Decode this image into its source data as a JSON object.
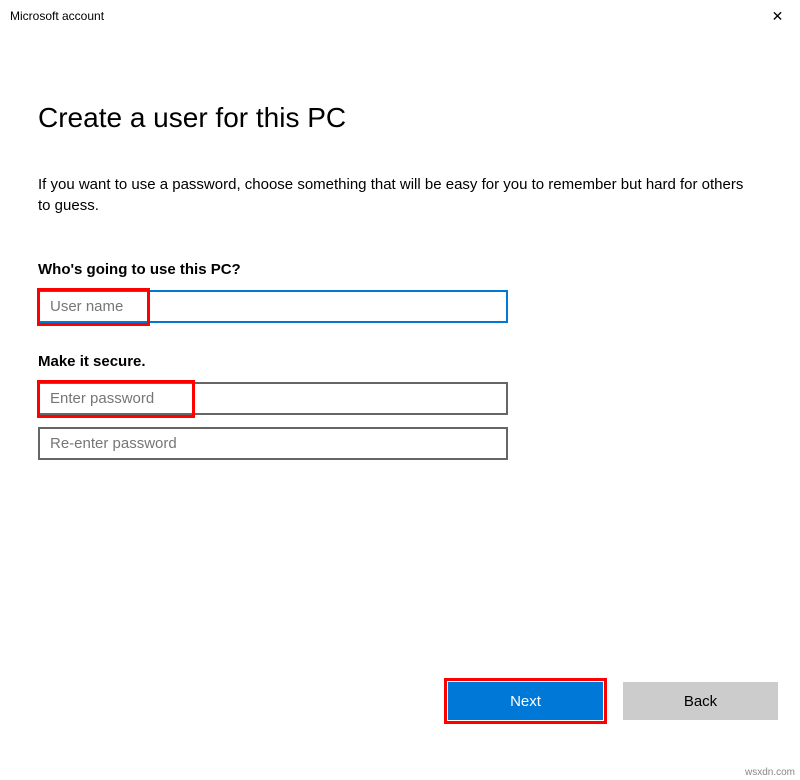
{
  "window": {
    "title": "Microsoft account",
    "close_glyph": "✕"
  },
  "header": {
    "heading": "Create a user for this PC",
    "description": "If you want to use a password, choose something that will be easy for you to remember but hard for others to guess."
  },
  "sections": {
    "who": {
      "label": "Who's going to use this PC?",
      "username": {
        "placeholder": "User name",
        "value": ""
      }
    },
    "secure": {
      "label": "Make it secure.",
      "password": {
        "placeholder": "Enter password",
        "value": ""
      },
      "reenter": {
        "placeholder": "Re-enter password",
        "value": ""
      }
    }
  },
  "buttons": {
    "next": "Next",
    "back": "Back"
  },
  "watermark": "wsxdn.com",
  "colors": {
    "accent": "#0078d7",
    "highlight": "#ff0000",
    "secondary_button": "#cccccc"
  }
}
